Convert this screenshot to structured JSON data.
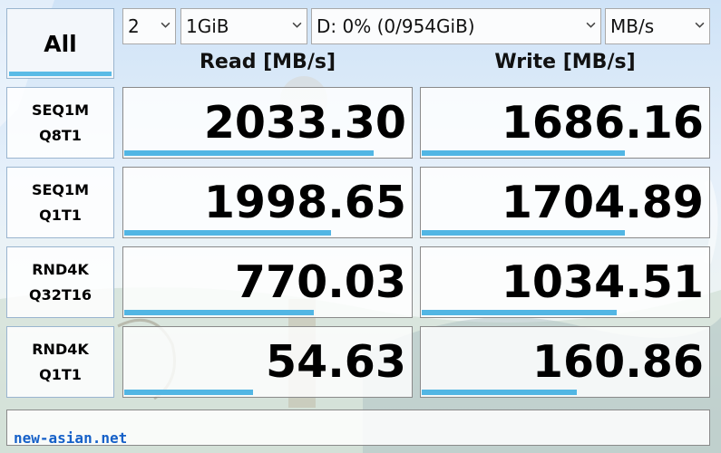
{
  "toolbar": {
    "all_label": "All",
    "count_value": "2",
    "size_value": "1GiB",
    "drive_value": "D: 0% (0/954GiB)",
    "unit_value": "MB/s"
  },
  "headers": {
    "read": "Read [MB/s]",
    "write": "Write [MB/s]"
  },
  "rows": [
    {
      "line1": "SEQ1M",
      "line2": "Q8T1",
      "read": "2033.30",
      "write": "1686.16",
      "read_bar": 0.87,
      "write_bar": 0.71
    },
    {
      "line1": "SEQ1M",
      "line2": "Q1T1",
      "read": "1998.65",
      "write": "1704.89",
      "read_bar": 0.72,
      "write_bar": 0.71
    },
    {
      "line1": "RND4K",
      "line2": "Q32T16",
      "read": "770.03",
      "write": "1034.51",
      "read_bar": 0.66,
      "write_bar": 0.68
    },
    {
      "line1": "RND4K",
      "line2": "Q1T1",
      "read": "54.63",
      "write": "160.86",
      "read_bar": 0.45,
      "write_bar": 0.54
    }
  ],
  "status_text": "",
  "watermark": "new-asian.net",
  "colors": {
    "bar": "#52b6e4",
    "accent": "#5bbbe6"
  }
}
